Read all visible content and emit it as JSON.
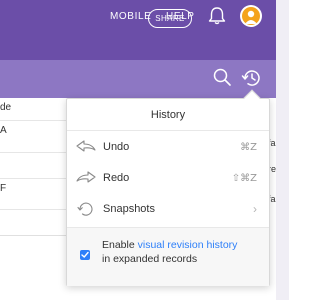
{
  "topbar": {
    "mobile_label": "MOBILE",
    "help_label": "HELP",
    "bell_icon": "bell-icon",
    "avatar_icon": "avatar"
  },
  "toolbar": {
    "share_label": "SHARE",
    "search_icon": "search-icon",
    "history_icon": "history-icon"
  },
  "table": {
    "rows": [
      "de",
      "A",
      "",
      "F",
      ""
    ],
    "right_cells": [
      "",
      "fa",
      "re",
      "fa",
      ""
    ]
  },
  "history_menu": {
    "title": "History",
    "items": [
      {
        "label": "Undo",
        "shortcut": "⌘Z",
        "icon": "undo-icon"
      },
      {
        "label": "Redo",
        "shortcut": "⇧⌘Z",
        "icon": "redo-icon"
      },
      {
        "label": "Snapshots",
        "shortcut": "",
        "icon": "snapshots-icon"
      }
    ],
    "footer": {
      "checked": true,
      "text_before": "Enable ",
      "link_text": "visual revision history",
      "text_after": "in expanded records"
    }
  },
  "colors": {
    "topbar": "#6b4ea8",
    "toolbar": "#8d77c3",
    "link": "#2d7ff9",
    "avatar": "#f4a31d"
  }
}
